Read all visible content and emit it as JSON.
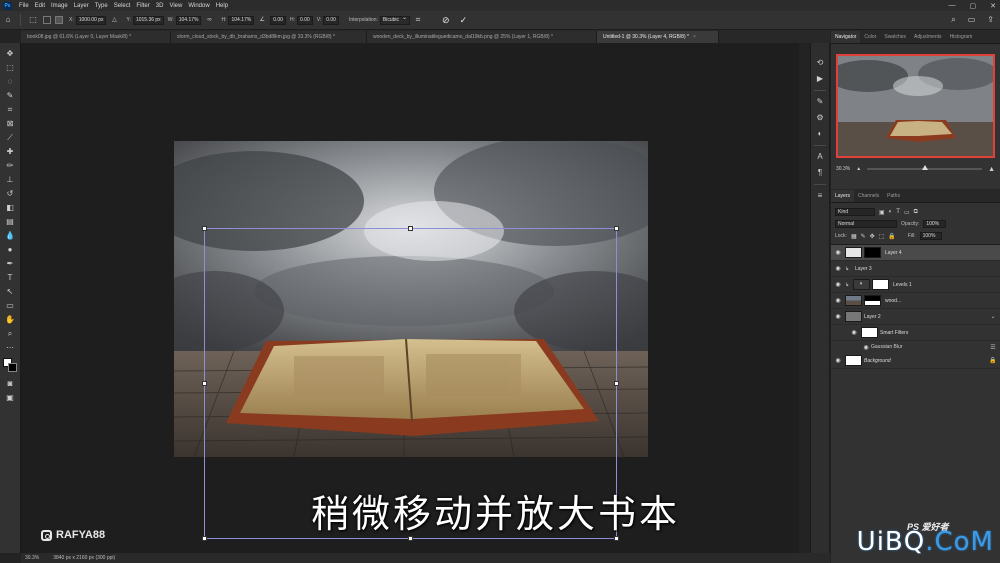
{
  "menubar": {
    "logo": "Ps",
    "items": [
      "File",
      "Edit",
      "Image",
      "Layer",
      "Type",
      "Select",
      "Filter",
      "3D",
      "View",
      "Window",
      "Help"
    ],
    "win_controls": [
      "—",
      "▢",
      "✕"
    ]
  },
  "options": {
    "x_label": "X:",
    "x_value": "1000.00 px",
    "y_label": "Y:",
    "y_value": "1015.36 px",
    "w_label": "W:",
    "w_value": "104.17%",
    "h_label": "H:",
    "h_value": "104.17%",
    "angle_value": "0.00",
    "hskew_label": "H:",
    "hskew_value": "0.00",
    "vskew_label": "V:",
    "vskew_value": "0.00",
    "interp_label": "Interpolation:",
    "interp_value": "Bicubic"
  },
  "tabs": [
    {
      "label": "book08.jpg @ 61.6% (Layer 0, Layer Mask/8) *",
      "active": false
    },
    {
      "label": "storm_cloud_stock_by_db_brahams_d3bd8lkm.jpg @ 33.3% (RGB/8) *",
      "active": false
    },
    {
      "label": "wooden_deck_by_illuminatileguedicamo_dal19kb.png @ 25% (Layer 1, RGB/8) *",
      "active": false
    },
    {
      "label": "Untitled-1 @ 30.3% (Layer 4, RGB/8) *",
      "active": true
    }
  ],
  "canvas": {
    "subtitle": "稍微移动并放大书本",
    "creator_handle": "RAFYA88"
  },
  "statusbar": {
    "zoom": "30.3%",
    "doc_info": "3840 px x 2160 px (300 ppi)"
  },
  "navigator": {
    "tabs": [
      "Navigator",
      "Color",
      "Swatches",
      "Adjustments",
      "Histogram"
    ],
    "zoom": "30.3%"
  },
  "layers": {
    "tabs": [
      "Layers",
      "Channels",
      "Paths"
    ],
    "filter_label": "Kind",
    "blend_mode": "Normal",
    "opacity_label": "Opacity:",
    "opacity_value": "100%",
    "lock_label": "Lock:",
    "fill_label": "Fill:",
    "fill_value": "100%",
    "rows": [
      {
        "name": "Layer 4",
        "selected": true
      },
      {
        "name": "Layer 3",
        "selected": false
      },
      {
        "name": "Levels 1",
        "selected": false
      },
      {
        "name": "wood...",
        "selected": false
      },
      {
        "name": "Layer 2",
        "selected": false
      },
      {
        "name": "Smart Filters",
        "selected": false
      },
      {
        "name": "Gaussian Blur",
        "selected": false
      },
      {
        "name": "Background",
        "selected": false
      }
    ]
  },
  "watermark": {
    "ps_text": "PS 爱好者",
    "site_text_a": "UiBQ",
    "site_text_b": ".CoM"
  },
  "colors": {
    "accent_red": "#e0413a",
    "transform_box": "#8f8fd8",
    "brand_blue": "#31a8ff"
  }
}
